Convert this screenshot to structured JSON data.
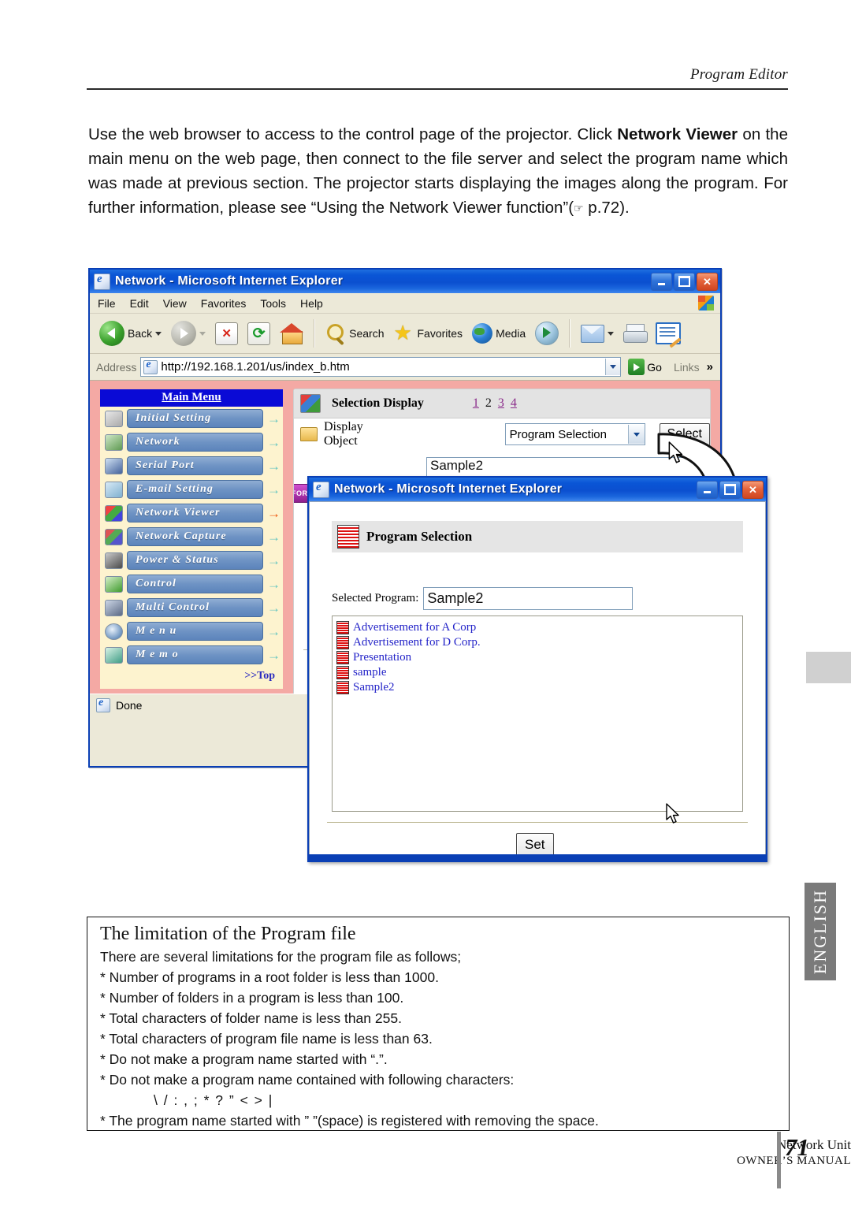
{
  "header": {
    "running_title": "Program Editor"
  },
  "intro": {
    "part1": "Use the web browser to access to the control page of the projector. Click ",
    "bold1": "Network Viewer",
    "part2": " on the main menu on the web page, then connect to the file server and select the program name which was made at previous section. The projector starts displaying the images along the program. For further information, please see “Using the Network Viewer function”(",
    "pointer_glyph": "☞",
    "part3": " p.72)."
  },
  "browser_main": {
    "title": "Network - Microsoft Internet Explorer",
    "window_buttons": {
      "minimize": "minimize-button",
      "maximize": "maximize-button",
      "close": "close-button"
    },
    "menus": [
      "File",
      "Edit",
      "View",
      "Favorites",
      "Tools",
      "Help"
    ],
    "toolbar": {
      "back": "Back",
      "forward": "",
      "stop": "stop-icon",
      "refresh": "refresh-icon",
      "home": "home-icon",
      "search": "Search",
      "favorites": "Favorites",
      "media": "Media",
      "history": "history-icon",
      "mail": "mail-icon",
      "print": "print-icon",
      "edit": "edit-icon"
    },
    "address": {
      "label": "Address",
      "url": "http://192.168.1.201/us/index_b.htm",
      "go": "Go",
      "links": "Links",
      "chevron": "»"
    },
    "status": "Done"
  },
  "sidebar": {
    "title": "Main Menu",
    "items": [
      {
        "label": "Initial Setting",
        "arrow": "→",
        "active": false
      },
      {
        "label": "Network",
        "arrow": "→",
        "active": false
      },
      {
        "label": "Serial Port",
        "arrow": "→",
        "active": false
      },
      {
        "label": "E-mail Setting",
        "arrow": "→",
        "active": false
      },
      {
        "label": "Network Viewer",
        "arrow": "→",
        "active": true
      },
      {
        "label": "Network Capture",
        "arrow": "→",
        "active": false
      },
      {
        "label": "Power & Status",
        "arrow": "→",
        "active": false
      },
      {
        "label": "Control",
        "arrow": "→",
        "active": false
      },
      {
        "label": "Multi Control",
        "arrow": "→",
        "active": false
      },
      {
        "label": "M e n u",
        "arrow": "→",
        "active": false
      },
      {
        "label": "M e m o",
        "arrow": "→",
        "active": false
      }
    ],
    "top_link": ">>Top"
  },
  "content_panel": {
    "section_title": "Selection Display",
    "pager": [
      {
        "label": "1",
        "current": false
      },
      {
        "label": "2",
        "current": true
      },
      {
        "label": "3",
        "current": false
      },
      {
        "label": "4",
        "current": false
      }
    ],
    "display_object_label": "Display Object",
    "display_object_value": "Program Selection",
    "select_button": "Select",
    "hidden_field_value": "Sample2",
    "forward_chip": "FORW"
  },
  "dialog": {
    "title": "Network - Microsoft Internet Explorer",
    "section_title": "Program Selection",
    "selected_program_label": "Selected Program:",
    "selected_program_value": "Sample2",
    "programs": [
      "Advertisement for A Corp",
      "Advertisement for D Corp.",
      "Presentation",
      "sample",
      "Sample2"
    ],
    "set_button": "Set"
  },
  "limitation": {
    "title": "The limitation of the Program file",
    "lines": [
      "There are several limitations for the program file as follows;",
      "* Number of programs in a root folder is less than 1000.",
      "* Number of folders in a program is less than 100.",
      "* Total characters of folder name is less than 255.",
      "* Total characters of program file name is less than 63.",
      "* Do not make a program name started with “.”.",
      "* Do not make a program name contained with following characters:"
    ],
    "charlist": "\\ / : , ; * ? ” < > |",
    "last_line": "* The program name started with ” ”(space) is registered with removing the space."
  },
  "side_tab": {
    "label": "ENGLISH"
  },
  "footer": {
    "line1": "Network Unit",
    "line2": "OWNER’S MANUAL",
    "page_number": "71"
  }
}
